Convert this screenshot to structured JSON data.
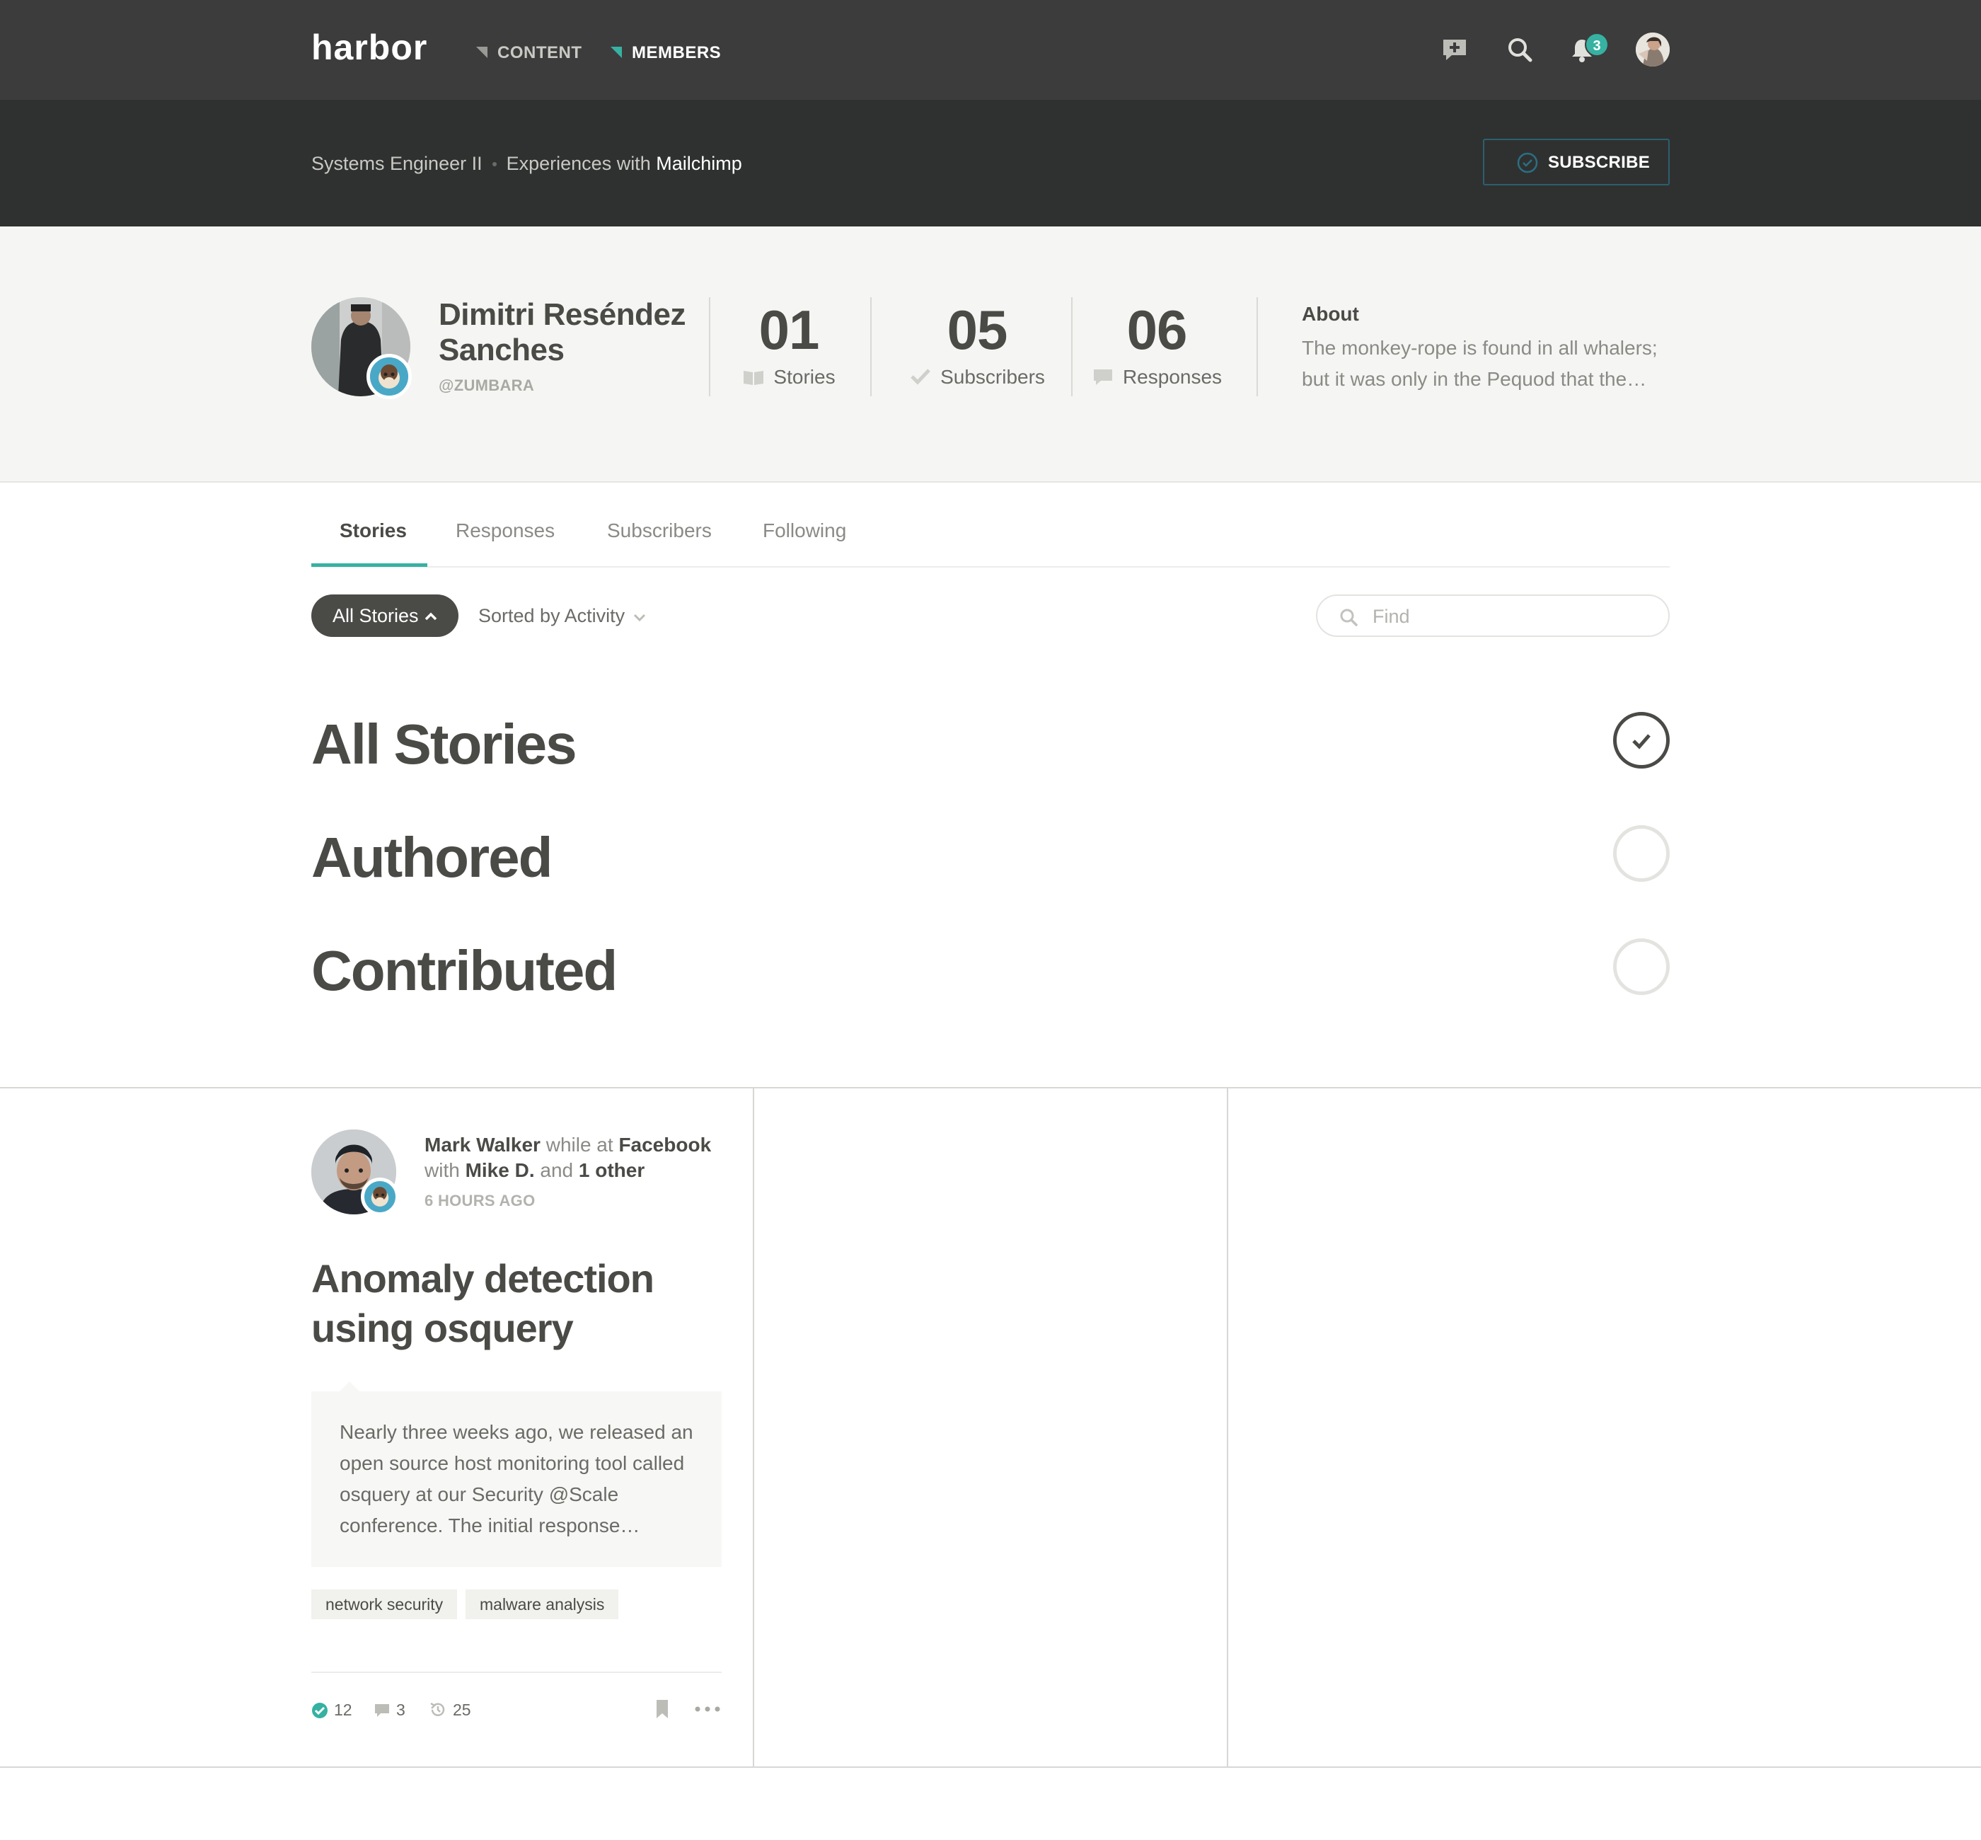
{
  "app": {
    "logo": "harbor",
    "nav": [
      {
        "label": "CONTENT",
        "active": false
      },
      {
        "label": "MEMBERS",
        "active": true
      }
    ],
    "notifications_count": "3",
    "accent_color": "#36b1a2"
  },
  "subbar": {
    "crumb_1": "Systems Engineer II",
    "crumb_2_prefix": "Experiences with",
    "crumb_2_strong": "Mailchimp",
    "subscribe_label": "SUBSCRIBE"
  },
  "profile": {
    "name": "Dimitri Reséndez Sanches",
    "handle": "@ZUMBARA",
    "stats": [
      {
        "num": "01",
        "label": "Stories",
        "icon": "book-icon"
      },
      {
        "num": "05",
        "label": "Subscribers",
        "icon": "check-icon"
      },
      {
        "num": "06",
        "label": "Responses",
        "icon": "comment-icon"
      }
    ],
    "about_title": "About",
    "about_text": "The monkey-rope is found in all whalers; but it was only in the Pequod that the…"
  },
  "tabs": [
    {
      "label": "Stories",
      "active": true
    },
    {
      "label": "Responses",
      "active": false
    },
    {
      "label": "Subscribers",
      "active": false
    },
    {
      "label": "Following",
      "active": false
    }
  ],
  "filters": {
    "pill_label": "All Stories",
    "sort_label": "Sorted by Activity",
    "find_placeholder": "Find"
  },
  "options": [
    {
      "label": "All Stories",
      "selected": true
    },
    {
      "label": "Authored",
      "selected": false
    },
    {
      "label": "Contributed",
      "selected": false
    }
  ],
  "card": {
    "author": "Mark Walker",
    "while_at": "while at",
    "org": "Facebook",
    "with": "with",
    "coauthor": "Mike D.",
    "and": "and",
    "others": "1 other",
    "time": "6 HOURS AGO",
    "title": "Anomaly detection using osquery",
    "excerpt": "Nearly three weeks ago, we released an open source host monitoring tool called osquery at our Security @Scale conference. The initial response…",
    "tags": [
      "network security",
      "malware analysis"
    ],
    "recommends": "12",
    "comments": "3",
    "views": "25"
  }
}
